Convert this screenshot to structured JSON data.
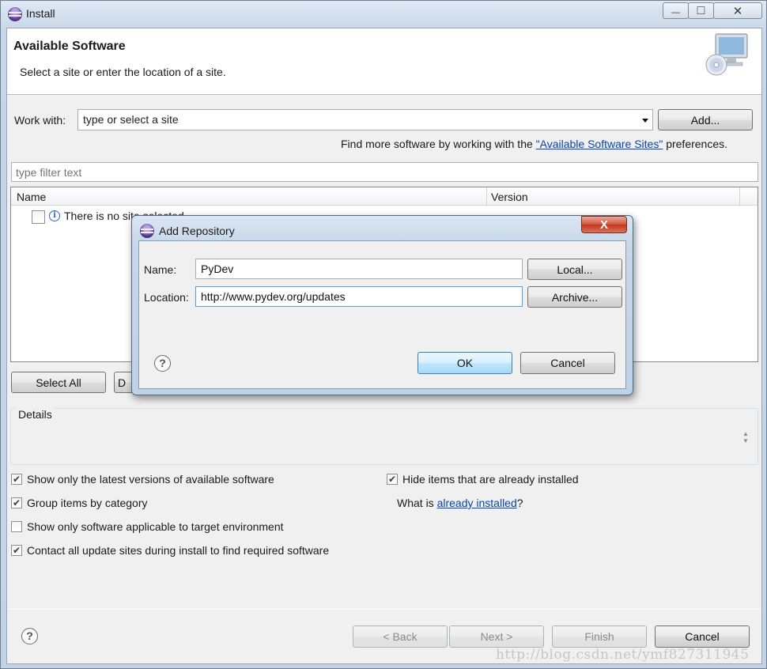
{
  "window": {
    "title": "Install",
    "caption_minimize": "—",
    "caption_maximize": "□",
    "caption_close": "✕"
  },
  "header": {
    "title": "Available Software",
    "subtitle": "Select a site or enter the location of a site."
  },
  "work_with": {
    "label": "Work with:",
    "combo_value": "type or select a site",
    "add_button": "Add..."
  },
  "find_more": {
    "prefix": "Find more software by working with the ",
    "link": "\"Available Software Sites\"",
    "suffix": " preferences."
  },
  "filter": {
    "placeholder": "type filter text"
  },
  "table": {
    "columns": [
      "Name",
      "Version"
    ],
    "rows": [
      {
        "name": "There is no site selected.",
        "checked": false,
        "icon": "info-icon"
      }
    ]
  },
  "selection_buttons": {
    "select_all": "Select All",
    "deselect_all_partial": "D"
  },
  "details": {
    "label": "Details"
  },
  "options": {
    "left": [
      {
        "label": "Show only the latest versions of available software",
        "checked": true
      },
      {
        "label": "Group items by category",
        "checked": true
      },
      {
        "label": "Show only software applicable to target environment",
        "checked": false
      },
      {
        "label": "Contact all update sites during install to find required software",
        "checked": true
      }
    ],
    "hide_installed": {
      "label": "Hide items that are already installed",
      "checked": true
    },
    "what_is": {
      "prefix": "What is ",
      "link": "already installed",
      "suffix": "?"
    }
  },
  "footer": {
    "back": "< Back",
    "next": "Next >",
    "finish": "Finish",
    "cancel": "Cancel"
  },
  "dialog": {
    "title": "Add Repository",
    "close": "X",
    "name_label": "Name:",
    "name_value": "PyDev",
    "location_label": "Location:",
    "location_value": "http://www.pydev.org/updates",
    "local_button": "Local...",
    "archive_button": "Archive...",
    "ok_button": "OK",
    "cancel_button": "Cancel"
  },
  "watermark": "http://blog.csdn.net/ymf827311945",
  "icons": {
    "help": "?",
    "info": "i",
    "check": "✔",
    "scroll_up": "▲",
    "scroll_down": "▼"
  },
  "colors": {
    "link": "#0645ad",
    "default_button": "#a7d9f5",
    "dialog_close": "#c3361c"
  }
}
